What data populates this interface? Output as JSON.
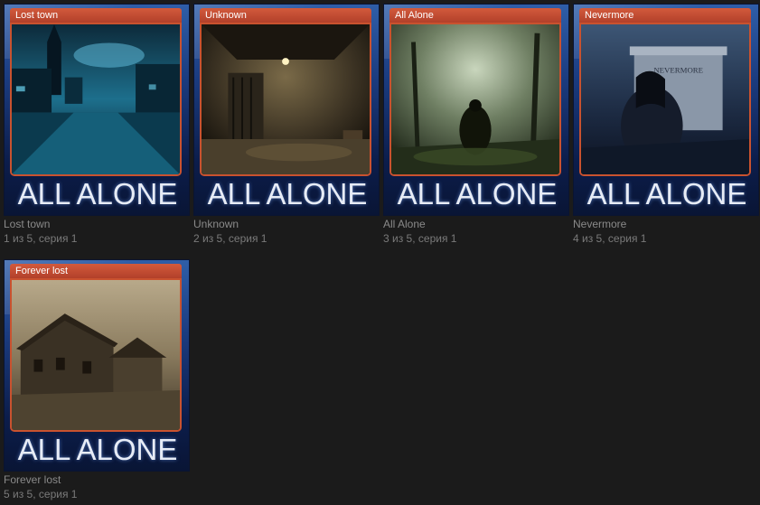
{
  "brand_text": "ALL ALONE",
  "colors": {
    "background": "#1b1b1b",
    "title_bar": "#c14b31",
    "card_frame": "#1b3c80",
    "caption": "#8a8a8a"
  },
  "cards": [
    {
      "title": "Lost town",
      "name": "Lost town",
      "series_info": "1 из 5, серия 1"
    },
    {
      "title": "Unknown",
      "name": "Unknown",
      "series_info": "2 из 5, серия 1"
    },
    {
      "title": "All Alone",
      "name": "All Alone",
      "series_info": "3 из 5, серия 1"
    },
    {
      "title": "Nevermore",
      "name": "Nevermore",
      "series_info": "4 из 5, серия 1",
      "art_text": "NEVERMORE"
    },
    {
      "title": "Forever lost",
      "name": "Forever lost",
      "series_info": "5 из 5, серия 1"
    }
  ]
}
